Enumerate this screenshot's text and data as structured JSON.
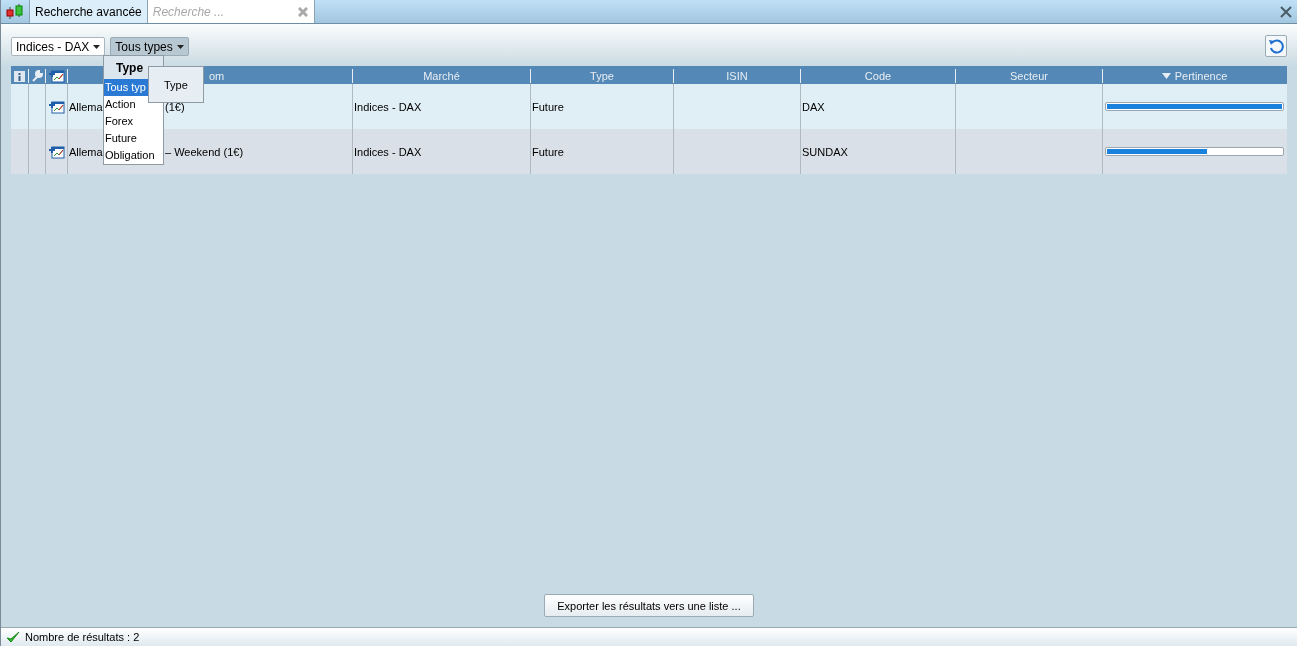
{
  "tabs": [
    {
      "label": "Recherche avancée",
      "selected": true
    }
  ],
  "search": {
    "placeholder": "Recherche ..."
  },
  "filters": [
    {
      "label": "Indices - DAX",
      "open": false
    },
    {
      "label": "Tous types",
      "open": true
    }
  ],
  "table": {
    "columns": [
      "om",
      "Marché",
      "Type",
      "ISIN",
      "Code",
      "Secteur",
      "Pertinence"
    ],
    "rows": [
      {
        "nom_start": "Allema",
        "nom_end": "(1€)",
        "marche": "Indices - DAX",
        "type": "Future",
        "isin": "",
        "code": "DAX",
        "secteur": "",
        "level": 1.0
      },
      {
        "nom_start": "Allema",
        "nom_end": "– Weekend (1€)",
        "marche": "Indices - DAX",
        "type": "Future",
        "isin": "",
        "code": "SUNDAX",
        "secteur": "",
        "level": 0.57
      }
    ]
  },
  "type_menu": {
    "title": "Type",
    "items": [
      {
        "label": "Tous typ",
        "selected": true
      },
      {
        "label": "Action",
        "selected": false
      },
      {
        "label": "Forex",
        "selected": false
      },
      {
        "label": "Future",
        "selected": false
      },
      {
        "label": "Obligation",
        "selected": false
      }
    ]
  },
  "tooltip": "Type",
  "export_button": "Exporter les résultats vers une liste ...",
  "status_bar": "Nombre de résultats : 2"
}
